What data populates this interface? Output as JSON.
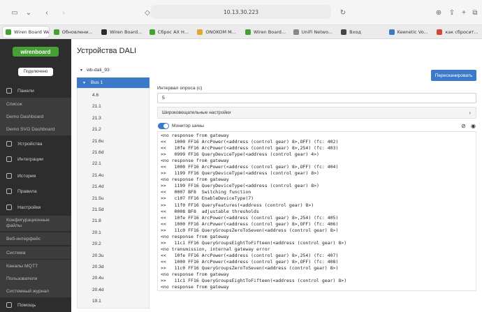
{
  "browser": {
    "url": "10.13.30.223",
    "tabs": [
      {
        "label": "Wiren Board Web UI",
        "color": "#46a135",
        "active": true
      },
      {
        "label": "Обновлени...",
        "color": "#46a135"
      },
      {
        "label": "Wiren Board...",
        "color": "#2d2d2d"
      },
      {
        "label": "Сброс АХ Н...",
        "color": "#46a135"
      },
      {
        "label": "ONOKOM M...",
        "color": "#e9a13a"
      },
      {
        "label": "Wiren Board...",
        "color": "#46a135"
      },
      {
        "label": "UniFi Netwo...",
        "color": "#888888"
      },
      {
        "label": "Вход",
        "color": "#444444"
      },
      {
        "label": "Keenetic Vo...",
        "color": "#3a7ac9"
      },
      {
        "label": "как сбросит...",
        "color": "#d44638"
      }
    ]
  },
  "sidebar": {
    "logo": "wirenboard",
    "status": "Подключено",
    "items": [
      {
        "label": "Панели",
        "type": "main"
      },
      {
        "label": "Список",
        "type": "sub"
      },
      {
        "label": "Demo Dashboard",
        "type": "sub"
      },
      {
        "label": "Demo SVG Dashboard",
        "type": "sub"
      },
      {
        "label": "Устройства",
        "type": "main"
      },
      {
        "label": "Интеграции",
        "type": "main"
      },
      {
        "label": "История",
        "type": "main"
      },
      {
        "label": "Правила",
        "type": "main"
      },
      {
        "label": "Настройки",
        "type": "main"
      },
      {
        "label": "Конфигурационные файлы",
        "type": "sub"
      },
      {
        "label": "Веб-интерфейс",
        "type": "sub"
      },
      {
        "label": "Система",
        "type": "sub"
      },
      {
        "label": "Каналы MQTT",
        "type": "sub"
      },
      {
        "label": "Пользователи",
        "type": "sub"
      },
      {
        "label": "Системный журнал",
        "type": "sub"
      },
      {
        "label": "Помощь",
        "type": "main"
      }
    ]
  },
  "main": {
    "title": "Устройства DALI",
    "tree_root": "wb-dali_93",
    "bus_label": "Bus 1",
    "devices": [
      "4.6",
      "21.1",
      "21.3",
      "21.2",
      "21.6u",
      "21.6d",
      "22.1",
      "21.4u",
      "21.4d",
      "21.5u",
      "21.5d",
      "21.8",
      "20.1",
      "20.2",
      "20.3u",
      "20.3d",
      "20.4u",
      "20.4d",
      "19.1"
    ],
    "rescan_label": "Пересканировать",
    "interval_label": "Интервал опроса (с)",
    "interval_value": "5",
    "broadcast_label": "Широковещательные настройки",
    "monitor_label": "Монитор шины",
    "log": [
      "<no response from gateway",
      "<<   1000 FF16 ArcPower(<address (control gear) 8>,OFF) (fc: 402)",
      "<<   10fe FF16 ArcPower(<address (control gear) 8>,254) (fc: 403)",
      ">>   0999 FF16 QueryDeviceType(<address (control gear) 4>)",
      "<no response from gateway",
      "<<   1000 FF16 ArcPower(<address (control gear) 8>,OFF) (fc: 404)",
      ">>   1199 FF16 QueryDeviceType(<address (control gear) 8>)",
      "<no response from gateway",
      ">>   1199 FF16 QueryDeviceType(<address (control gear) 8>)",
      "<<   0007 BF8  Switching function",
      ">>   c107 FF16 EnableDeviceType(7)",
      ">>   11f0 FF16 QueryFeatures(<address (control gear) 8>)",
      "<<   0008 BF8  adjustable thresholds",
      "<<   10fe FF16 ArcPower(<address (control gear) 8>,254) (fc: 405)",
      "<<   1000 FF16 ArcPower(<address (control gear) 8>,OFF) (fc: 406)",
      ">>   11c0 FF16 QueryGroupsZeroToSeven(<address (control gear) 8>)",
      "<no response from gateway",
      ">>   11c1 FF16 QueryGroupsEightToFifteen(<address (control gear) 8>)",
      "<no transmission, internal gateway error",
      "<<   10fe FF16 ArcPower(<address (control gear) 8>,254) (fc: 407)",
      "<<   1000 FF16 ArcPower(<address (control gear) 8>,OFF) (fc: 408)",
      ">>   11c0 FF16 QueryGroupsZeroToSeven(<address (control gear) 8>)",
      "<no response from gateway",
      ">>   11c1 FF16 QueryGroupsEightToFifteen(<address (control gear) 8>)",
      "<no response from gateway"
    ]
  }
}
